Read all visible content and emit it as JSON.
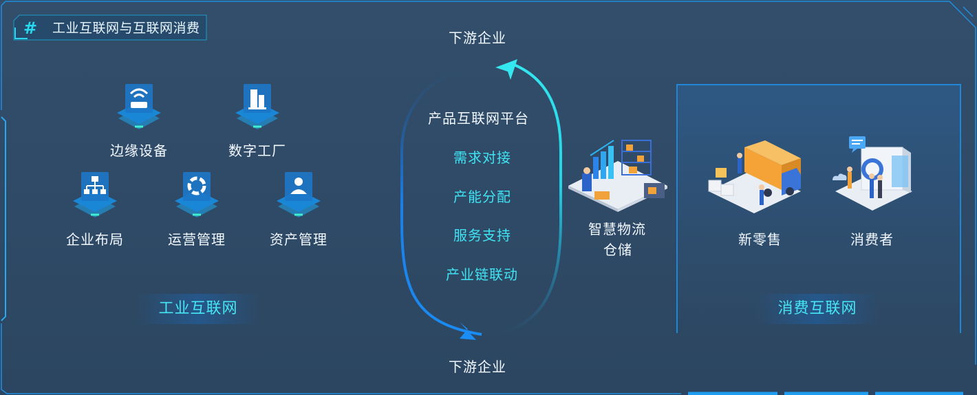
{
  "header": {
    "title": "工业互联网与互联网消费"
  },
  "industrial": {
    "section_label": "工业互联网",
    "items": [
      {
        "label": "边缘设备",
        "icon": "router-icon"
      },
      {
        "label": "数字工厂",
        "icon": "building-icon"
      },
      {
        "label": "企业布局",
        "icon": "org-chart-icon"
      },
      {
        "label": "运营管理",
        "icon": "lifebuoy-icon"
      },
      {
        "label": "资产管理",
        "icon": "person-icon"
      }
    ]
  },
  "loop": {
    "top_label": "下游企业",
    "bottom_label": "下游企业",
    "platform_title": "产品互联网平台",
    "items": [
      "需求对接",
      "产能分配",
      "服务支持",
      "产业链联动"
    ]
  },
  "logistics": {
    "line1": "智慧物流",
    "line2": "仓储",
    "icon": "warehouse-illustration-icon"
  },
  "consumer": {
    "section_label": "消费互联网",
    "items": [
      {
        "label": "新零售",
        "icon": "delivery-truck-illustration-icon"
      },
      {
        "label": "消费者",
        "icon": "consumer-illustration-icon"
      }
    ]
  },
  "colors": {
    "background": "#2f4a66",
    "accent_cyan": "#3fe4f4",
    "accent_blue": "#1e88d6",
    "text_white": "#f2f8ff"
  }
}
